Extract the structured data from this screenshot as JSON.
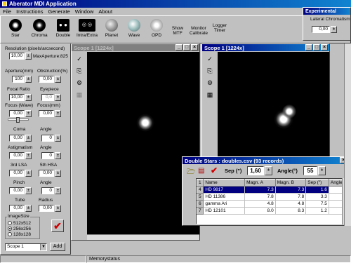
{
  "app_title": "Aberator MDI Application",
  "menu": [
    "File",
    "Instructions",
    "Generate",
    "Window",
    "About"
  ],
  "toolbar": {
    "tools": [
      {
        "label": "Star",
        "icon": "star-icon"
      },
      {
        "label": "Chroma",
        "icon": "chroma-icon"
      },
      {
        "label": "Double",
        "icon": "double-star-icon"
      },
      {
        "label": "Intra/Extra",
        "icon": "intra-extra-icon"
      },
      {
        "label": "Planet",
        "icon": "planet-icon"
      },
      {
        "label": "Wave",
        "icon": "wave-icon"
      },
      {
        "label": "OPD",
        "icon": "opd-icon"
      },
      {
        "label": "Show MTF",
        "icon": "mtf-icon"
      },
      {
        "label": "Monitor Calibrate",
        "icon": "monitor-icon"
      },
      {
        "label": "Logger Timer",
        "icon": "timer-icon"
      }
    ]
  },
  "experimental": {
    "title": "Experimental",
    "lateral_chromatism_label": "Lateral Chromatism",
    "lateral_chromatism_value": "0,00"
  },
  "left_panel": {
    "resolution_label": "Resolution (pixels/arcsecond)",
    "resolution_value": "10,00",
    "max_aperture": "MaxAperture:825",
    "aperture_label": "Aperture(mm)",
    "aperture_value": "100",
    "obstruction_label": "Obstruction(%)",
    "obstruction_value": "0,00",
    "focal_ratio_label": "Focal Ratio",
    "focal_ratio_value": "10,00",
    "eyepiece_label": "Eyepiece",
    "eyepiece_value": "0,0",
    "focus_wave_label": "Focus (Wave)",
    "focus_wave_value": "0,00",
    "focus_mm_label": "Focus(mm)",
    "focus_mm_value": "0,00",
    "coma_label": "Coma",
    "coma_value": "0,00",
    "coma_angle_label": "Angle",
    "coma_angle_value": "0",
    "astig_label": "Astigmatism",
    "astig_value": "0,00",
    "astig_angle_label": "Angle",
    "astig_angle_value": "0",
    "lsa3_label": "3rd LSA",
    "lsa3_value": "0,00",
    "hsa5_label": "5th HSA",
    "hsa5_value": "0,00",
    "pinch_label": "Pinch",
    "pinch_value": "0,00",
    "pinch_angle_label": "Angle",
    "pinch_angle_value": "0",
    "tube_label": "Tube",
    "tube_value": "0,00",
    "radius_label": "Radius",
    "radius_value": "0,00",
    "imagesize_label": "ImageSize",
    "imagesize_options": [
      "512x512",
      "256x256",
      "128x128"
    ],
    "imagesize_selected": 1,
    "scope_select": "Scope 1",
    "add_label": "Add"
  },
  "scopes": [
    {
      "title": "Scope 1 [1224x]"
    },
    {
      "title": "Scope 1 [1224x]"
    }
  ],
  "double_stars": {
    "title": "Double Stars : doubles.csv (93 records)",
    "sep_label": "Sep (\")",
    "sep_value": "1,60",
    "angle_label": "Angle(°)",
    "angle_value": "55",
    "columns": [
      "Name",
      "Magn. A",
      "Magn. B",
      "Sep (\")",
      "Angle (°)"
    ],
    "rows": [
      {
        "idx": "4",
        "name": "HD 9817",
        "ma": "7.3",
        "mb": "7.3",
        "sep": "1.6",
        "angle": ""
      },
      {
        "idx": "5",
        "name": "HD 11386",
        "ma": "7.8",
        "mb": "7.8",
        "sep": "3.3",
        "angle": ""
      },
      {
        "idx": "6",
        "name": "gamma Ari",
        "ma": "4.8",
        "mb": "4.8",
        "sep": "7.5",
        "angle": ""
      },
      {
        "idx": "7",
        "name": "HD 12101",
        "ma": "8.0",
        "mb": "8.3",
        "sep": "1.2",
        "angle": ""
      }
    ]
  },
  "status": {
    "panel1": "",
    "panel2": "Memorystatus"
  }
}
